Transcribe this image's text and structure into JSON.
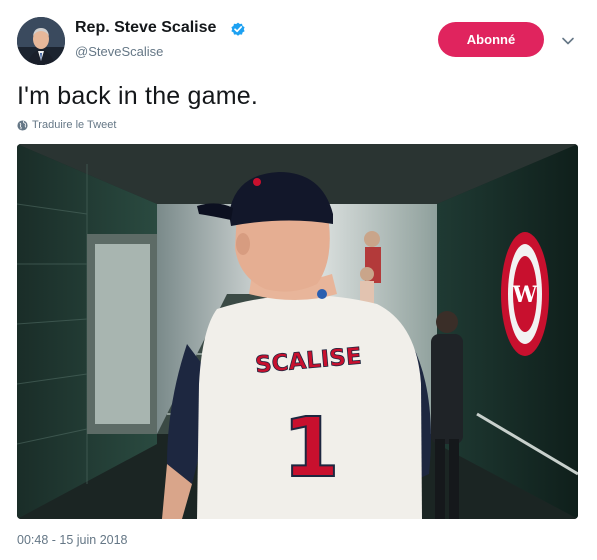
{
  "tweet": {
    "author_name": "Rep. Steve Scalise",
    "author_handle": "@SteveScalise",
    "follow_label": "Abonné",
    "text": "I'm back in the game.",
    "translate_label": "Traduire le Tweet",
    "timestamp": "00:48 - 15 juin 2018",
    "photo": {
      "jersey_name": "SCALISE",
      "jersey_number": "1"
    }
  },
  "icons": {
    "verified": "verified-badge-icon",
    "caret": "chevron-down-icon",
    "translate": "globe-icon"
  },
  "colors": {
    "follow_button": "#e0245e",
    "verified": "#1da1f2",
    "secondary_text": "#657786",
    "primary_text": "#14171a"
  }
}
